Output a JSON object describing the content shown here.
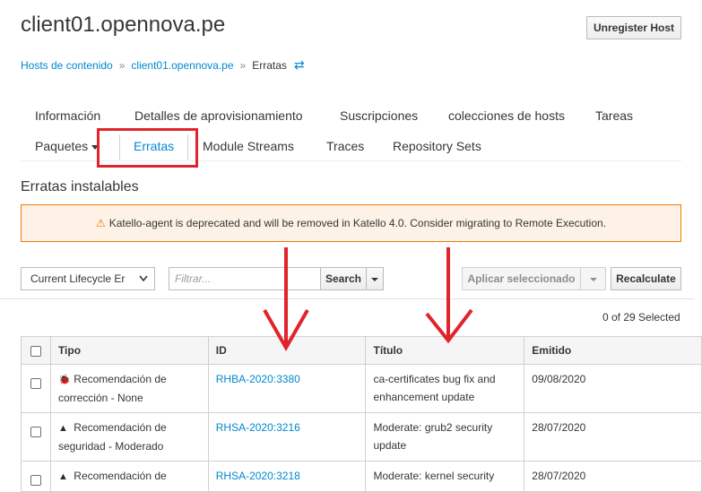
{
  "page": {
    "title": "client01.opennova.pe",
    "unregister_label": "Unregister Host"
  },
  "breadcrumb": {
    "items": [
      "Hosts de contenido",
      "client01.opennova.pe"
    ],
    "current": "Erratas",
    "switch_icon": "switcher-icon"
  },
  "tabs": {
    "row1": [
      "Información",
      "Detalles de aprovisionamiento",
      "Suscripciones",
      "colecciones de hosts",
      "Tareas"
    ],
    "row2": [
      "Paquetes",
      "Erratas",
      "Module Streams",
      "Traces",
      "Repository Sets"
    ],
    "active": "Erratas"
  },
  "section": {
    "title": "Erratas instalables"
  },
  "alert": {
    "icon": "warning-triangle-icon",
    "text": "Katello-agent is deprecated and will be removed in Katello 4.0. Consider migrating to Remote Execution."
  },
  "toolbar": {
    "lifecycle_value": "Current Lifecycle Er",
    "filter_placeholder": "Filtrar...",
    "search_label": "Search",
    "apply_label": "Aplicar seleccionado",
    "recalculate_label": "Recalculate"
  },
  "selection": {
    "count_text": "0 of 29 Selected"
  },
  "table": {
    "headers": [
      "Tipo",
      "ID",
      "Título",
      "Emitido"
    ],
    "rows": [
      {
        "type_icon": "bug-icon",
        "type_line1": "Recomendación de",
        "type_line2": "corrección - None",
        "id": "RHBA-2020:3380",
        "title_line1": "ca-certificates bug fix and",
        "title_line2": "enhancement update",
        "issued": "09/08/2020"
      },
      {
        "type_icon": "warning-triangle-icon",
        "type_line1": "Recomendación de",
        "type_line2": "seguridad - Moderado",
        "id": "RHSA-2020:3216",
        "title_line1": "Moderate: grub2 security",
        "title_line2": "update",
        "issued": "28/07/2020"
      },
      {
        "type_icon": "warning-triangle-icon",
        "type_line1": "Recomendación de",
        "type_line2": "",
        "id": "RHSA-2020:3218",
        "title_line1": "Moderate: kernel security",
        "title_line2": "",
        "issued": "28/07/2020"
      }
    ]
  },
  "colors": {
    "link": "#0088ce",
    "warning": "#ec7a08",
    "alert_bg": "#fdf2e5",
    "annotation_red": "#e0242b"
  }
}
